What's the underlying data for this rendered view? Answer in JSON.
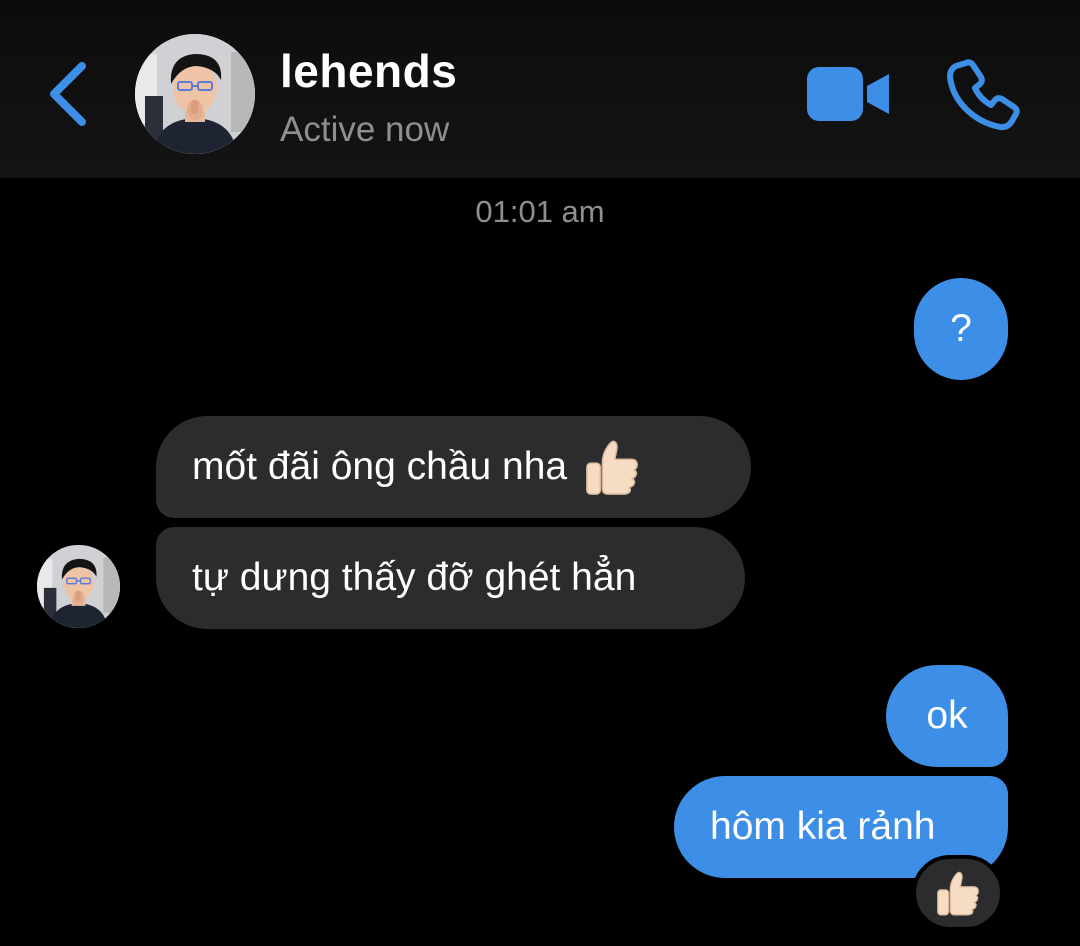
{
  "header": {
    "contact_name": "lehends",
    "status": "Active now",
    "accent_color": "#3d8ee6"
  },
  "conversation": {
    "timestamp": "01:01 am",
    "messages": [
      {
        "direction": "sent",
        "text": "?"
      },
      {
        "direction": "received",
        "text": "mốt đãi ông chầu nha",
        "emoji": "thumbs-up"
      },
      {
        "direction": "received",
        "text": "tự dưng thấy đỡ ghét hẳn"
      },
      {
        "direction": "sent",
        "text": "ok"
      },
      {
        "direction": "sent",
        "text": "hôm kia rảnh",
        "reaction": "thumbs-up"
      }
    ]
  },
  "colors": {
    "background": "#000000",
    "sent_bubble": "#3d8ee6",
    "received_bubble": "#2c2c2e",
    "secondary_text": "#8e8e93"
  },
  "icons": [
    "chevron-left-icon",
    "video-camera-icon",
    "phone-icon",
    "thumbs-up-icon"
  ]
}
